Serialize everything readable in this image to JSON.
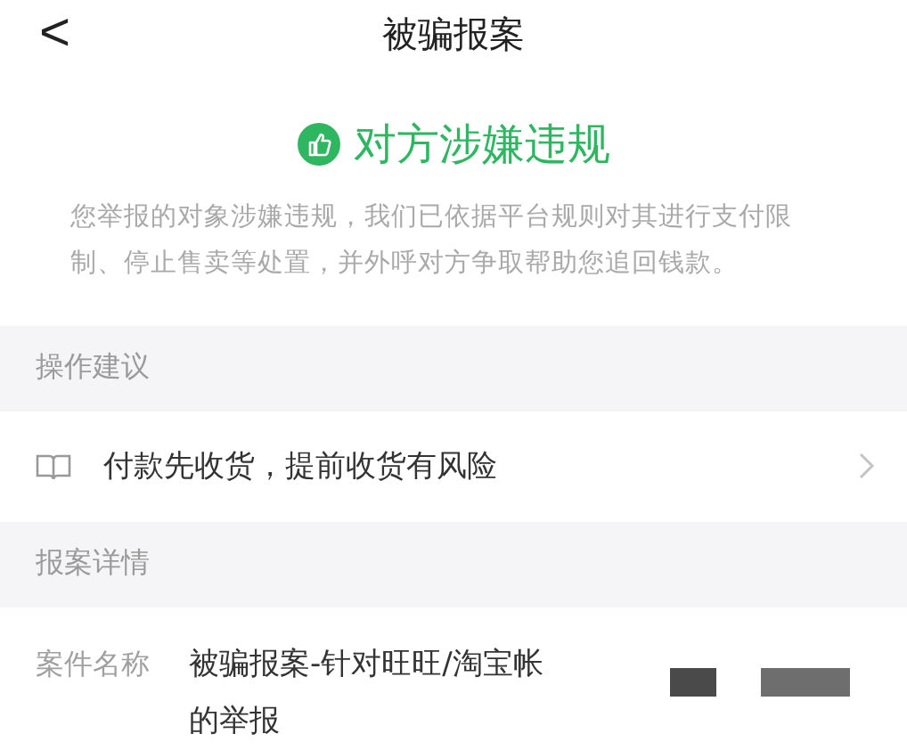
{
  "header": {
    "back": "<",
    "title": "被骗报案"
  },
  "status": {
    "title": "对方涉嫌违规",
    "description": "您举报的对象涉嫌违规，我们已依据平台规则对其进行支付限制、停止售卖等处置，并外呼对方争取帮助您追回钱款。"
  },
  "sections": [
    {
      "heading": "操作建议",
      "kind": "advice",
      "items": [
        {
          "text": "付款先收货，提前收货有风险"
        }
      ]
    },
    {
      "heading": "报案详情",
      "kind": "details",
      "items": [
        {
          "label": "案件名称",
          "value": "被骗报案-针对旺旺/淘宝帐的举报"
        }
      ]
    }
  ]
}
